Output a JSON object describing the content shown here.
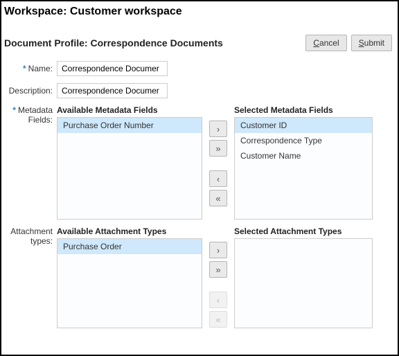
{
  "workspace": {
    "prefix": "Workspace: ",
    "name": "Customer workspace"
  },
  "profile": {
    "prefix": "Document Profile: ",
    "name": "Correspondence Documents"
  },
  "buttons": {
    "cancel": "Cancel",
    "submit": "Submit"
  },
  "fields": {
    "name_label": "Name:",
    "name_value": "Correspondence Documer",
    "description_label": "Description:",
    "description_value": "Correspondence Documer",
    "metadata_label": "Metadata Fields:",
    "attachment_label": "Attachment types:"
  },
  "metadata": {
    "available_title": "Available Metadata Fields",
    "selected_title": "Selected Metadata Fields",
    "available": [
      "Purchase Order Number"
    ],
    "selected": [
      "Customer ID",
      "Correspondence Type",
      "Customer Name"
    ]
  },
  "attachments": {
    "available_title": "Available Attachment Types",
    "selected_title": "Selected Attachment Types",
    "available": [
      "Purchase Order"
    ],
    "selected": []
  },
  "mover_glyphs": {
    "right": "›",
    "right_all": "»",
    "left": "‹",
    "left_all": "«"
  }
}
